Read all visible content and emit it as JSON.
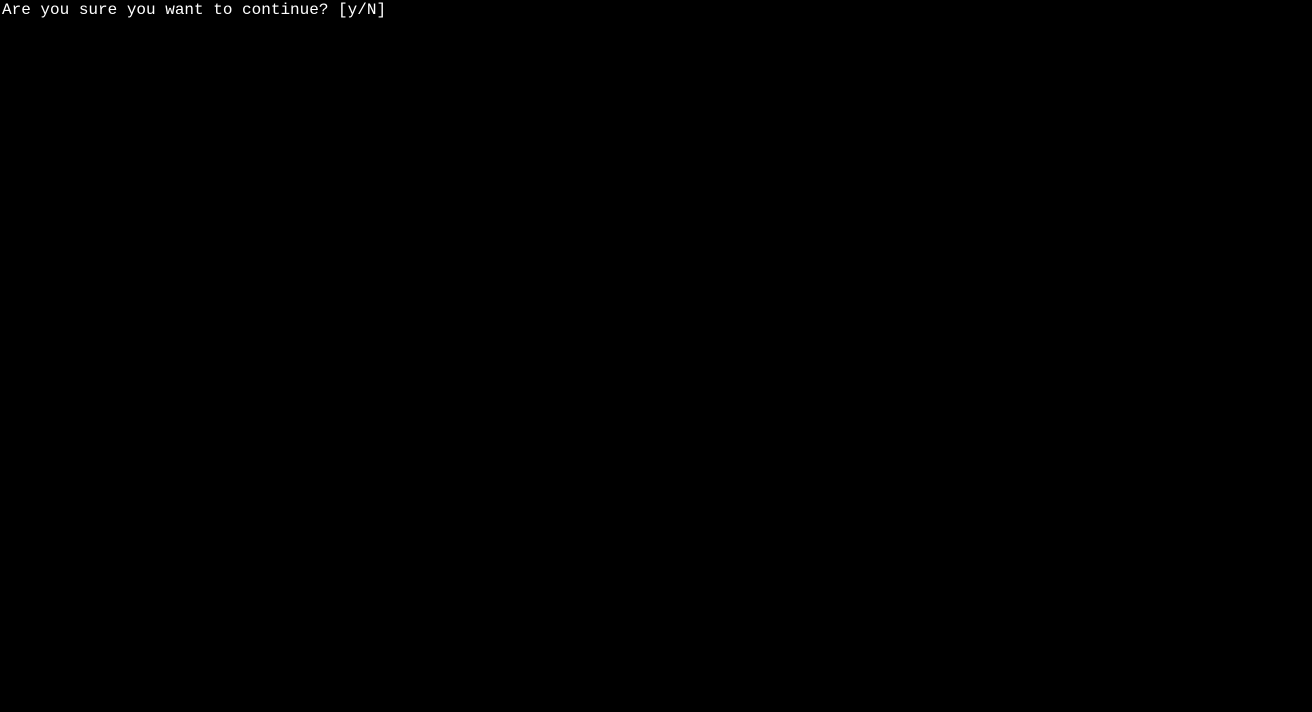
{
  "terminal": {
    "prompt_text": "Are you sure you want to continue? [y/N] "
  }
}
